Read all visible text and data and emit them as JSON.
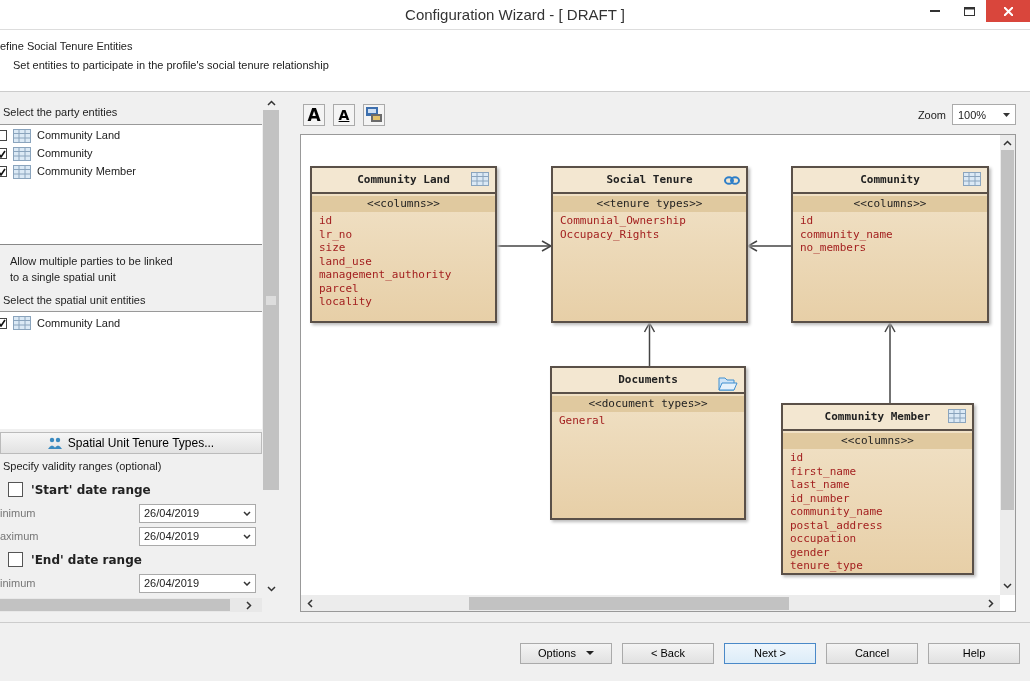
{
  "window": {
    "title": "Configuration Wizard - [ DRAFT ]"
  },
  "header": {
    "title": "efine Social Tenure Entities",
    "subtitle": "Set entities to participate in the profile's social tenure relationship"
  },
  "party_entities": {
    "label": "Select the party entities",
    "items": [
      {
        "label": "Community Land",
        "checked": false
      },
      {
        "label": "Community",
        "checked": true
      },
      {
        "label": "Community Member",
        "checked": true
      }
    ]
  },
  "allow_multiple": {
    "label": "Allow multiple parties to be linked to a single spatial unit"
  },
  "spatial_unit_entities": {
    "label": "Select the spatial unit entities",
    "items": [
      {
        "label": "Community Land",
        "checked": true
      }
    ]
  },
  "tenure_types_button": {
    "label": "Spatial Unit Tenure Types..."
  },
  "validity": {
    "label": "Specify validity ranges (optional)",
    "ranges": [
      {
        "label": "'Start' date range",
        "checked": false,
        "fields": [
          {
            "label": "inimum",
            "value": "26/04/2019"
          },
          {
            "label": "aximum",
            "value": "26/04/2019"
          }
        ]
      },
      {
        "label": "'End' date range",
        "checked": false,
        "fields": [
          {
            "label": "inimum",
            "value": "26/04/2019"
          }
        ]
      }
    ]
  },
  "toolbar": [
    {
      "kind": "font",
      "glyph": "A"
    },
    {
      "kind": "underline",
      "glyph": "A"
    },
    {
      "kind": "image"
    }
  ],
  "zoom": {
    "label": "Zoom",
    "value": "100%"
  },
  "diagram": {
    "entities": [
      {
        "name": "Community Land",
        "kind": "table",
        "section": "<<columns>>",
        "items": [
          "id",
          "lr_no",
          "size",
          "land_use",
          "management_authority",
          "parcel",
          "locality"
        ]
      },
      {
        "name": "Social Tenure",
        "kind": "link",
        "section": "<<tenure types>>",
        "items": [
          "Communial_Ownership",
          "Occupacy_Rights"
        ]
      },
      {
        "name": "Community",
        "kind": "table",
        "section": "<<columns>>",
        "items": [
          "id",
          "community_name",
          "no_members"
        ]
      },
      {
        "name": "Documents",
        "kind": "folder",
        "section": "<<document types>>",
        "items": [
          "General"
        ]
      },
      {
        "name": "Community Member",
        "kind": "table",
        "section": "<<columns>>",
        "items": [
          "id",
          "first_name",
          "last_name",
          "id_number",
          "community_name",
          "postal_address",
          "occupation",
          "gender",
          "tenure_type"
        ]
      }
    ]
  },
  "buttons": [
    {
      "label": "Options",
      "kind": "dropdown"
    },
    {
      "label": "< Back",
      "kind": "plain"
    },
    {
      "label": "Next >",
      "kind": "default"
    },
    {
      "label": "Cancel",
      "kind": "plain"
    },
    {
      "label": "Help",
      "kind": "plain"
    }
  ]
}
